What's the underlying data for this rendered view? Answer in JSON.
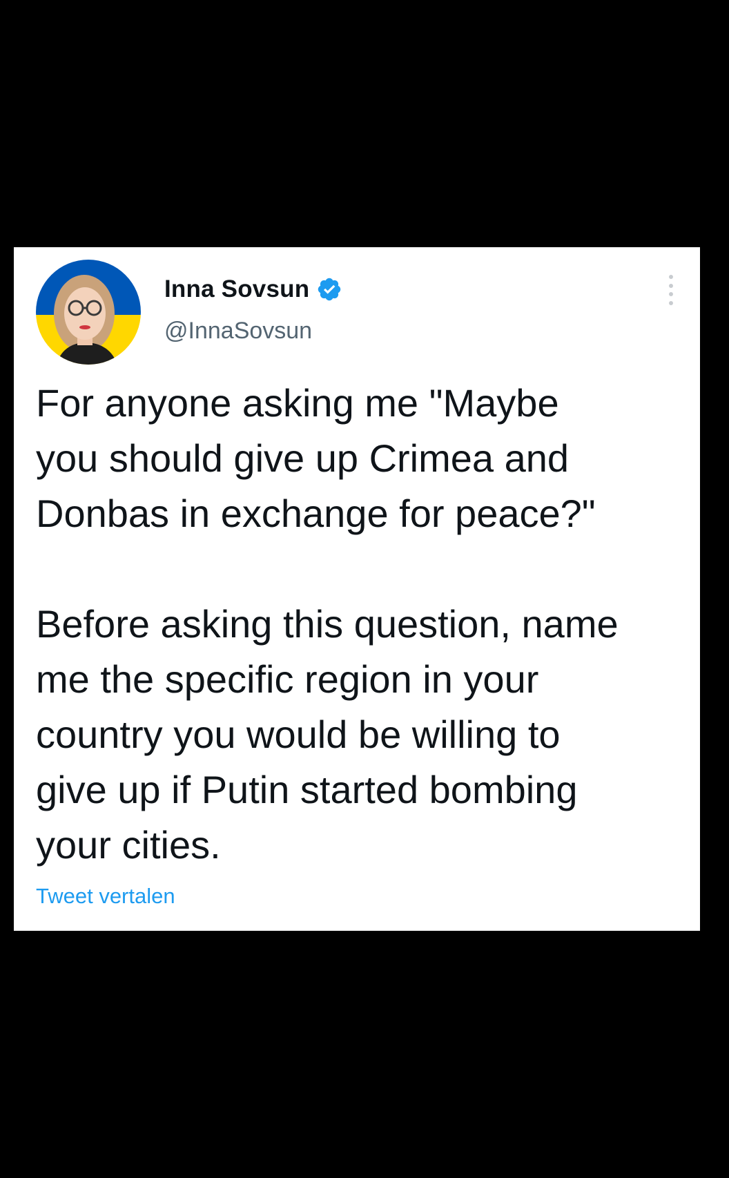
{
  "tweet": {
    "display_name": "Inna Sovsun",
    "verified": true,
    "handle": "@InnaSovsun",
    "paragraphs": [
      "For anyone asking me \"Maybe\nyou should give up Crimea and\nDonbas in exchange for peace?\"",
      "Before asking this question, name\nme the specific region in your\ncountry you would be willing to\ngive up if Putin started bombing\nyour cities."
    ],
    "translate_label": "Tweet vertalen"
  },
  "icons": {
    "verified": "verified-badge-icon",
    "more": "more-options-icon",
    "avatar": "profile-photo"
  },
  "colors": {
    "background": "#000000",
    "card": "#ffffff",
    "text": "#0f1419",
    "secondary_text": "#536471",
    "link": "#1d9bf0",
    "verified_badge": "#1d9bf0",
    "flag_blue": "#0057b7",
    "flag_yellow": "#ffd700"
  }
}
